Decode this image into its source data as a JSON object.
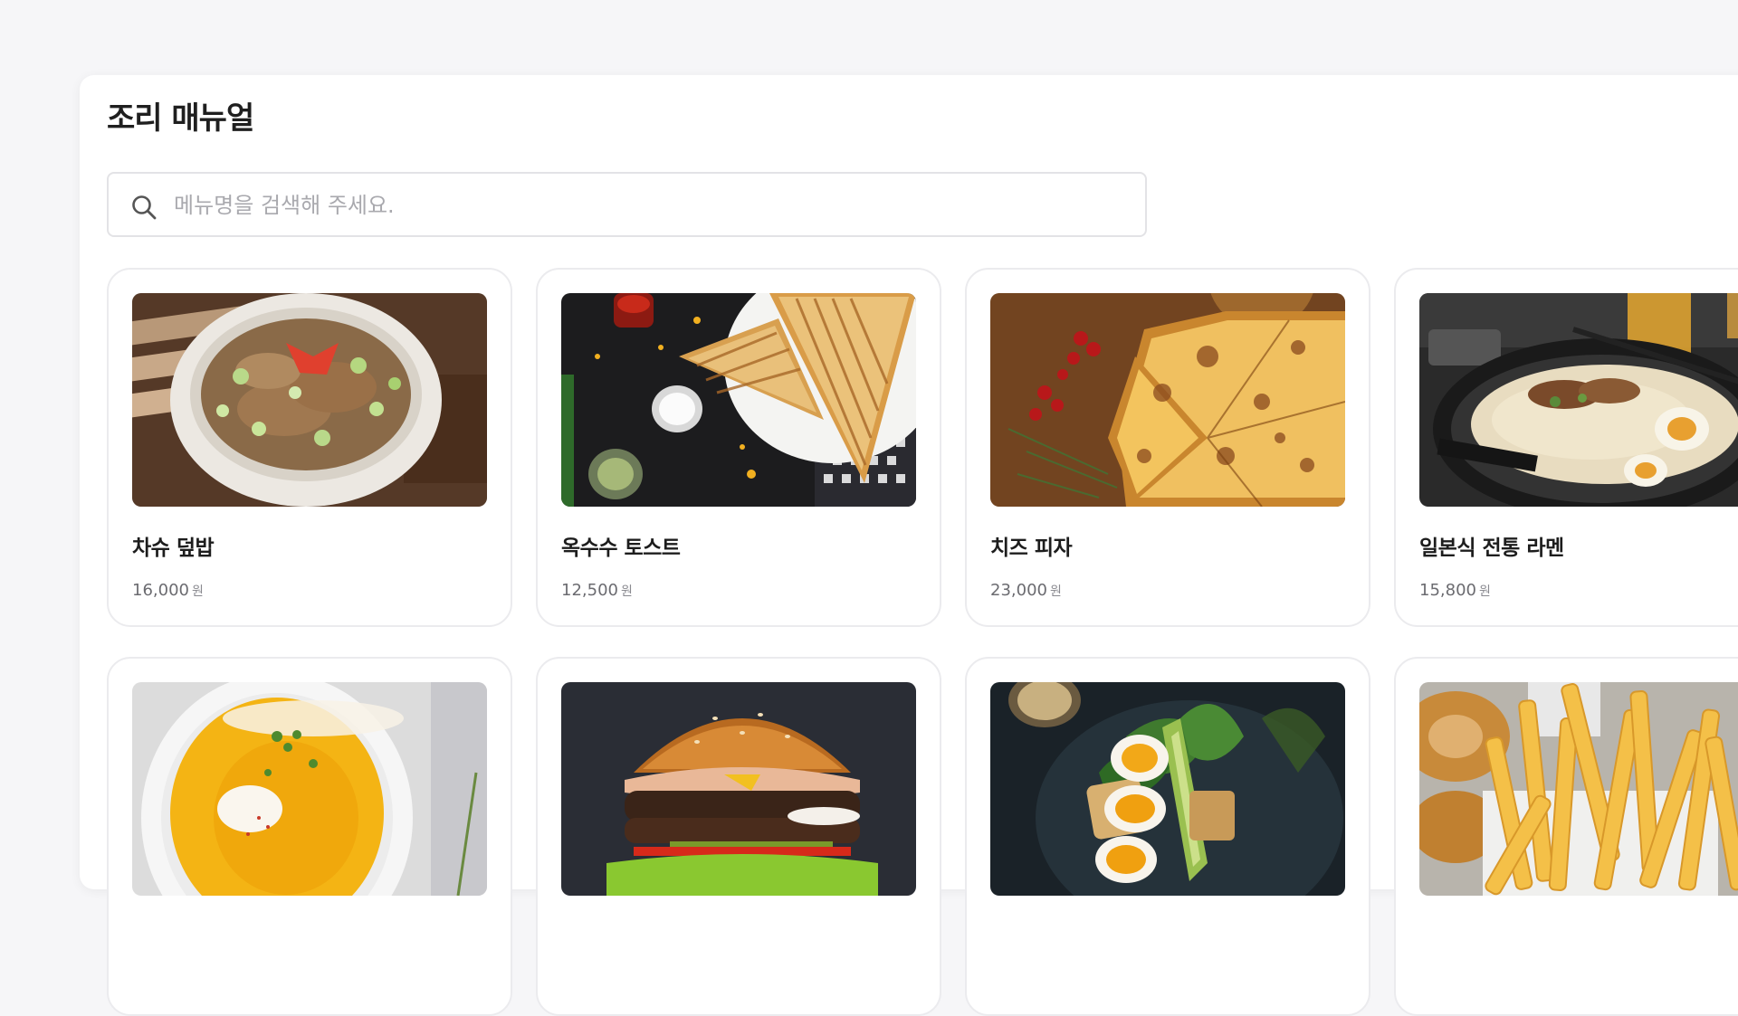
{
  "page": {
    "title": "조리 매뉴얼"
  },
  "search": {
    "placeholder": "메뉴명을 검색해 주세요.",
    "value": ""
  },
  "menu_items": [
    {
      "name": "차슈 덮밥",
      "price": "16,000",
      "unit": "원",
      "image": "chashu-rice-bowl-photo"
    },
    {
      "name": "옥수수 토스트",
      "price": "12,500",
      "unit": "원",
      "image": "corn-toast-photo"
    },
    {
      "name": "치즈 피자",
      "price": "23,000",
      "unit": "원",
      "image": "cheese-pizza-photo"
    },
    {
      "name": "일본식 전통 라멘",
      "price": "15,800",
      "unit": "원",
      "image": "ramen-photo"
    },
    {
      "name": "",
      "price": "",
      "unit": "",
      "image": "pumpkin-soup-photo"
    },
    {
      "name": "",
      "price": "",
      "unit": "",
      "image": "burger-photo"
    },
    {
      "name": "",
      "price": "",
      "unit": "",
      "image": "egg-avocado-salad-photo"
    },
    {
      "name": "",
      "price": "",
      "unit": "",
      "image": "french-fries-photo"
    }
  ]
}
